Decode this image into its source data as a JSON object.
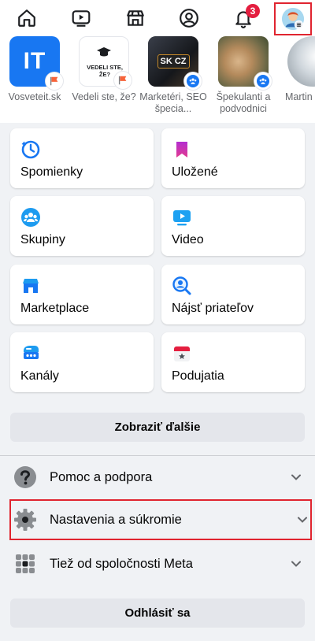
{
  "topnav": {
    "items": [
      {
        "icon": "home-icon"
      },
      {
        "icon": "video-icon"
      },
      {
        "icon": "marketplace-icon"
      },
      {
        "icon": "profile-icon"
      },
      {
        "icon": "bell-icon",
        "badge": "3"
      },
      {
        "icon": "menu-avatar-icon"
      }
    ]
  },
  "shortcuts": [
    {
      "label": "Vosveteit.sk",
      "thumb_text": "IT"
    },
    {
      "label": "Vedeli ste, že?",
      "thumb_text": "VEDELI STE, ŽE?"
    },
    {
      "label": "Marketéri, SEO špecia...",
      "thumb_text": "SK CZ"
    },
    {
      "label": "Špekulanti a podvodnici"
    },
    {
      "label": "Martin"
    }
  ],
  "grid": [
    {
      "label": "Spomienky",
      "icon": "memories-clock-icon"
    },
    {
      "label": "Uložené",
      "icon": "saved-bookmark-icon"
    },
    {
      "label": "Skupiny",
      "icon": "groups-icon"
    },
    {
      "label": "Video",
      "icon": "video-play-icon"
    },
    {
      "label": "Marketplace",
      "icon": "marketplace-shop-icon"
    },
    {
      "label": "Nájsť priateľov",
      "icon": "find-friends-icon"
    },
    {
      "label": "Kanály",
      "icon": "channels-icon"
    },
    {
      "label": "Podujatia",
      "icon": "events-calendar-icon"
    }
  ],
  "show_more_label": "Zobraziť ďalšie",
  "sections": [
    {
      "label": "Pomoc a podpora",
      "icon": "help-icon"
    },
    {
      "label": "Nastavenia a súkromie",
      "icon": "settings-gear-icon"
    },
    {
      "label": "Tiež od spoločnosti Meta",
      "icon": "meta-apps-grid-icon"
    }
  ],
  "logout_label": "Odhlásiť sa",
  "colors": {
    "accent": "#1877f2",
    "highlight_outline": "#e0242f",
    "badge": "#e41e3f",
    "background": "#f0f2f5"
  }
}
